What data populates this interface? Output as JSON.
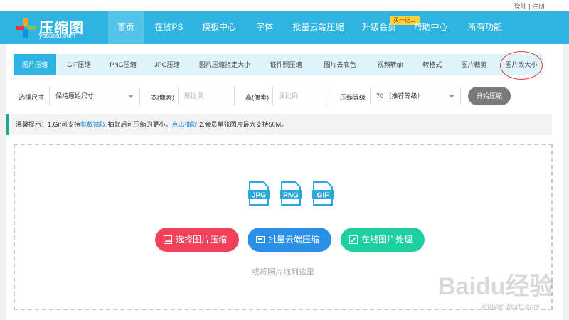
{
  "topbar": {
    "login": "登陆",
    "separator": " | ",
    "register": "注册"
  },
  "logo": {
    "name": "压缩图",
    "domain": "yasuotu.com"
  },
  "nav": {
    "items": [
      "首页",
      "在线PS",
      "模板中心",
      "字体",
      "批量云端压缩",
      "升级会员",
      "帮助中心",
      "所有功能"
    ],
    "promo_badge": "买一送二"
  },
  "tabs": [
    "图片压缩",
    "GIF压缩",
    "PNG压缩",
    "JPG压缩",
    "图片压缩指定大小",
    "证件照压缩",
    "图片去底色",
    "视频转gif",
    "转格式",
    "图片裁剪",
    "图片改大小"
  ],
  "controls": {
    "size_label": "选择尺寸",
    "size_value": "保持原始尺寸",
    "width_label": "宽(像素)",
    "width_placeholder": "原比例",
    "height_label": "高(像素)",
    "height_placeholder": "原比例",
    "level_label": "压缩等级",
    "level_value": "70 （推荐等级）",
    "start_button": "开始压缩"
  },
  "tip": {
    "prefix": "温馨提示：1.Gif可支持",
    "link1": "帧数抽取",
    "middle": ",抽取后可压缩的更小。",
    "link2": "点击抽取",
    "suffix": " 2.会员单张图片最大支持50M。"
  },
  "dropzone": {
    "file_types": [
      "JPG",
      "PNG",
      "GIF"
    ],
    "buttons": [
      {
        "label": "选择图片压缩",
        "color": "#f0405a",
        "icon": "image-icon"
      },
      {
        "label": "批量云端压缩",
        "color": "#2a8fe6",
        "icon": "cloud-zip-icon"
      },
      {
        "label": "在线图片处理",
        "color": "#1ecfa0",
        "icon": "edit-image-icon"
      }
    ],
    "hint": "或将照片拖到这里"
  },
  "watermark": {
    "brand": "Baidu经验",
    "url": "jingyan.baidu.com"
  },
  "colors": {
    "nav": "#2fb3e0",
    "tab_bg": "#dff3fb",
    "accent_green": "#1aa98f",
    "ring": "#e03a3a"
  }
}
